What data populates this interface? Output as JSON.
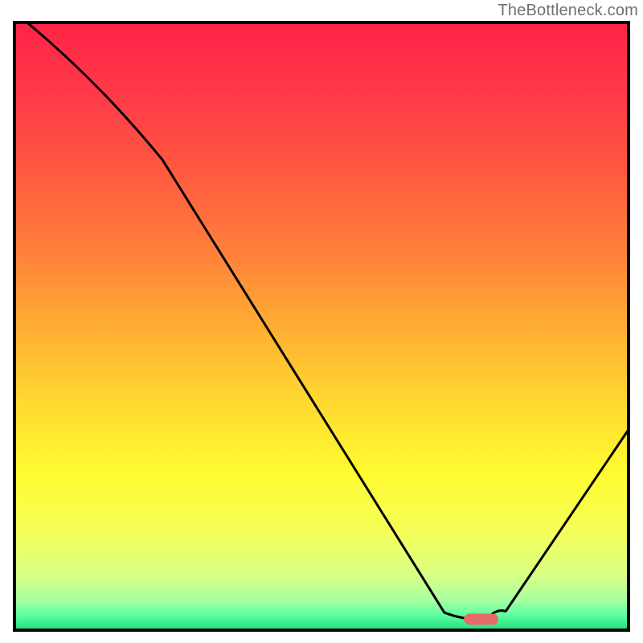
{
  "watermark": "TheBottleneck.com",
  "chart_data": {
    "type": "line",
    "title": "",
    "xlabel": "",
    "ylabel": "",
    "xlim": [
      0,
      100
    ],
    "ylim": [
      0,
      100
    ],
    "x": [
      2.3,
      24.1,
      70.0,
      76.9,
      80.0,
      100.0
    ],
    "values": [
      99.8,
      77.4,
      2.9,
      1.8,
      3.1,
      33.0
    ],
    "marker": {
      "x": 76.0,
      "y": 1.8,
      "width": 5.6,
      "height": 2.0,
      "color": "#e66a6a"
    },
    "gradient_stops": [
      {
        "pos": 0.0,
        "color": "#ff2446"
      },
      {
        "pos": 0.12,
        "color": "#ff3a49"
      },
      {
        "pos": 0.25,
        "color": "#ff5a3f"
      },
      {
        "pos": 0.38,
        "color": "#ff813a"
      },
      {
        "pos": 0.5,
        "color": "#ffad34"
      },
      {
        "pos": 0.62,
        "color": "#ffd730"
      },
      {
        "pos": 0.74,
        "color": "#fffb2f"
      },
      {
        "pos": 0.84,
        "color": "#f4ff5a"
      },
      {
        "pos": 0.91,
        "color": "#d8ff85"
      },
      {
        "pos": 0.95,
        "color": "#a9ffa0"
      },
      {
        "pos": 0.975,
        "color": "#5effa0"
      },
      {
        "pos": 1.0,
        "color": "#1cdf7f"
      }
    ],
    "colors": {
      "frame": "#000000",
      "curve": "#000000",
      "marker": "#e66a6a"
    }
  }
}
